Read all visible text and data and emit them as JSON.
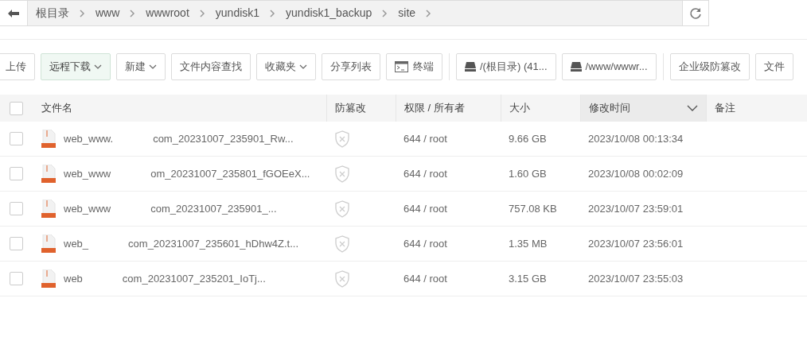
{
  "breadcrumb": {
    "items": [
      "根目录",
      "www",
      "wwwroot",
      "yundisk1",
      "yundisk1_backup",
      "site"
    ]
  },
  "toolbar": [
    {
      "label": "上传",
      "kind": "plain",
      "dropdown": false,
      "selected": false
    },
    {
      "label": "远程下载",
      "kind": "plain",
      "dropdown": true,
      "selected": true
    },
    {
      "label": "新建",
      "kind": "plain",
      "dropdown": true,
      "selected": false
    },
    {
      "label": "文件内容查找",
      "kind": "plain",
      "dropdown": false,
      "selected": false
    },
    {
      "label": "收藏夹",
      "kind": "plain",
      "dropdown": true,
      "selected": false
    },
    {
      "label": "分享列表",
      "kind": "plain",
      "dropdown": false,
      "selected": false
    },
    {
      "label": "终端",
      "kind": "terminal",
      "dropdown": false,
      "selected": false
    },
    {
      "kind": "divider"
    },
    {
      "label": "/(根目录) (41...",
      "kind": "disk",
      "dropdown": false,
      "selected": false
    },
    {
      "label": "/www/wwwr...",
      "kind": "disk",
      "dropdown": false,
      "selected": false
    },
    {
      "kind": "divider"
    },
    {
      "label": "企业级防篡改",
      "kind": "plain",
      "dropdown": false,
      "selected": false
    },
    {
      "label": "文件",
      "kind": "plain",
      "dropdown": false,
      "selected": false
    }
  ],
  "table": {
    "select_all_checked": false,
    "columns": [
      {
        "label": "文件名",
        "sorted": false
      },
      {
        "label": "防篡改",
        "sorted": false
      },
      {
        "label": "权限 / 所有者",
        "sorted": false
      },
      {
        "label": "大小",
        "sorted": false
      },
      {
        "label": "修改时间",
        "sorted": true
      },
      {
        "label": "备注",
        "sorted": false
      }
    ],
    "rows": [
      {
        "checked": false,
        "name_start": "web_www.",
        "name_end": "com_20231007_235901_Rw...",
        "permission": "644 / root",
        "size": "9.66 GB",
        "modified": "2023/10/08 00:13:34"
      },
      {
        "checked": false,
        "name_start": "web_www",
        "name_end": "om_20231007_235801_fGOEeX...",
        "permission": "644 / root",
        "size": "1.60 GB",
        "modified": "2023/10/08 00:02:09"
      },
      {
        "checked": false,
        "name_start": "web_www",
        "name_end": "com_20231007_235901_...",
        "permission": "644 / root",
        "size": "757.08 KB",
        "modified": "2023/10/07 23:59:01"
      },
      {
        "checked": false,
        "name_start": "web_",
        "name_end": "com_20231007_235601_hDhw4Z.t...",
        "permission": "644 / root",
        "size": "1.35 MB",
        "modified": "2023/10/07 23:56:01"
      },
      {
        "checked": false,
        "name_start": "web",
        "name_end": "com_20231007_235201_IoTj...",
        "permission": "644 / root",
        "size": "3.15 GB",
        "modified": "2023/10/07 23:55:03"
      }
    ]
  }
}
